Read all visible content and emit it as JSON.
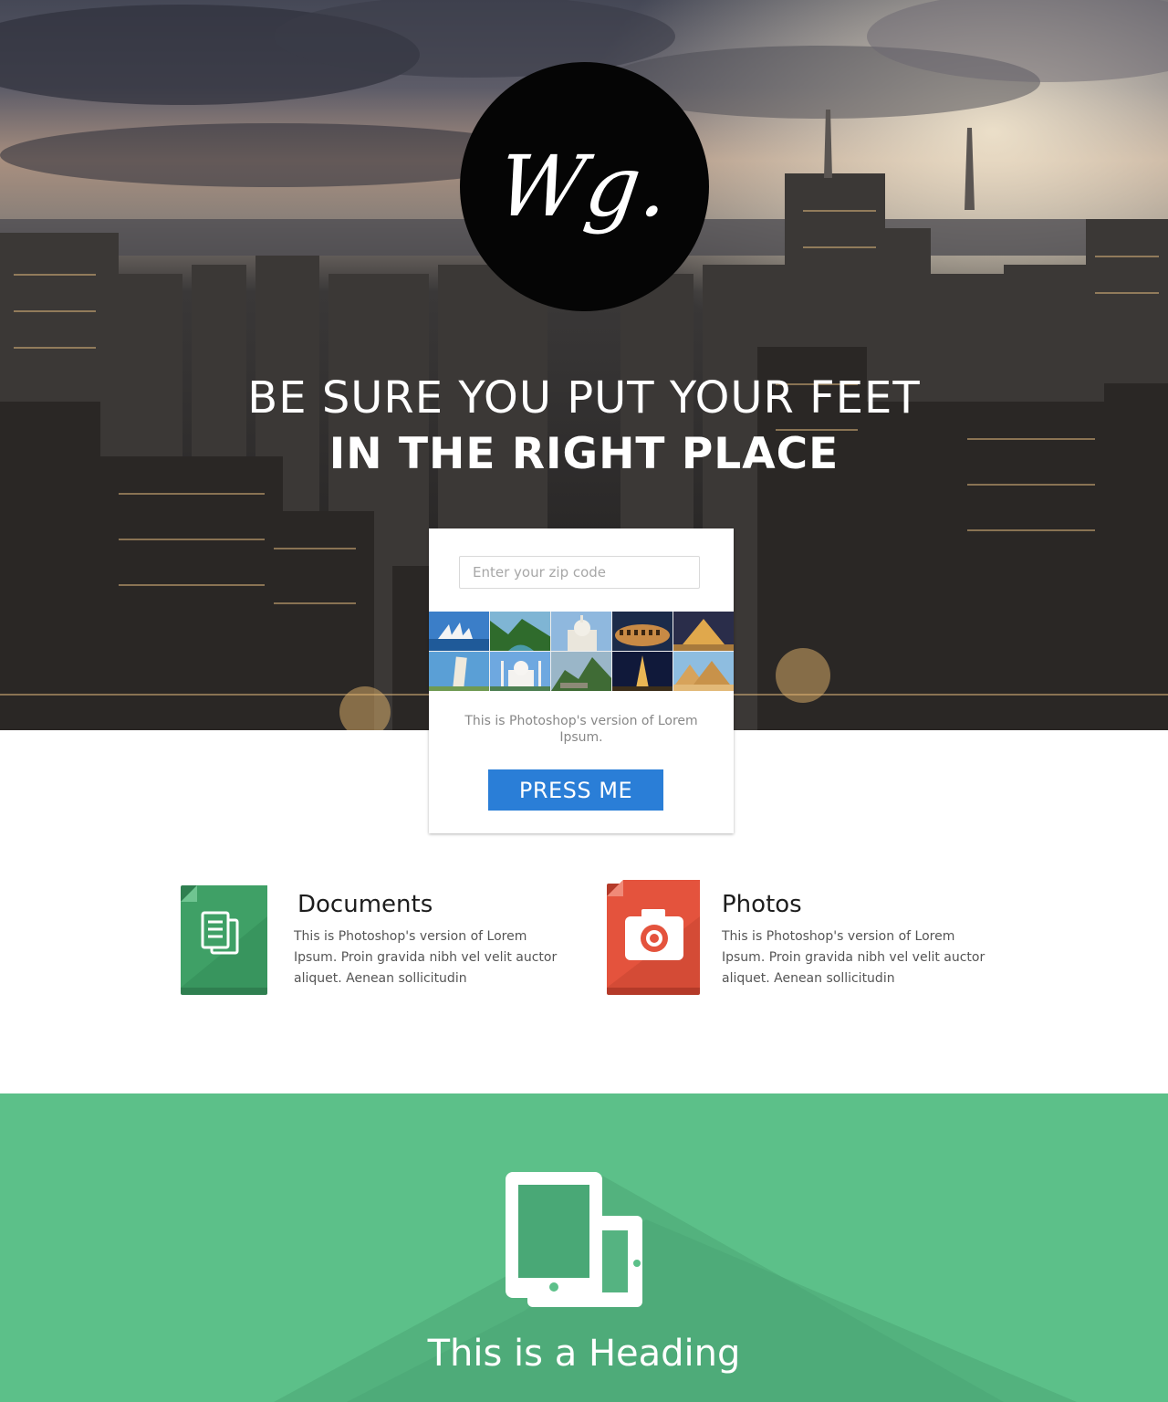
{
  "hero": {
    "logo_text": "Wg.",
    "headline_line1": "BE SURE YOU PUT YOUR FEET",
    "headline_line2": "IN THE RIGHT PLACE"
  },
  "card": {
    "zip_placeholder": "Enter your zip code",
    "description": "This is Photoshop's version  of Lorem Ipsum.",
    "button_label": "PRESS ME",
    "photos": [
      "sydney-opera-house",
      "river-valley",
      "sacre-coeur",
      "colosseum",
      "louvre-pyramid",
      "leaning-tower-pisa",
      "taj-mahal",
      "machu-picchu",
      "eiffel-tower-night",
      "giza-pyramids"
    ]
  },
  "features": [
    {
      "title": "Documents",
      "text": "This is Photoshop's version  of Lorem Ipsum. Proin gravida nibh vel velit auctor aliquet. Aenean sollicitudin",
      "icon": "documents-icon",
      "color": "#3fa066"
    },
    {
      "title": "Photos",
      "text": "This is Photoshop's version  of Lorem Ipsum. Proin gravida nibh vel velit auctor aliquet. Aenean sollicitudin",
      "icon": "camera-icon",
      "color": "#e4533d"
    }
  ],
  "green_section": {
    "heading": "This is a Heading",
    "icon": "devices-icon",
    "color": "#5cc089"
  },
  "colors": {
    "button": "#2a7ed7",
    "green": "#5cc089",
    "documents": "#3fa066",
    "photos": "#e4533d"
  }
}
